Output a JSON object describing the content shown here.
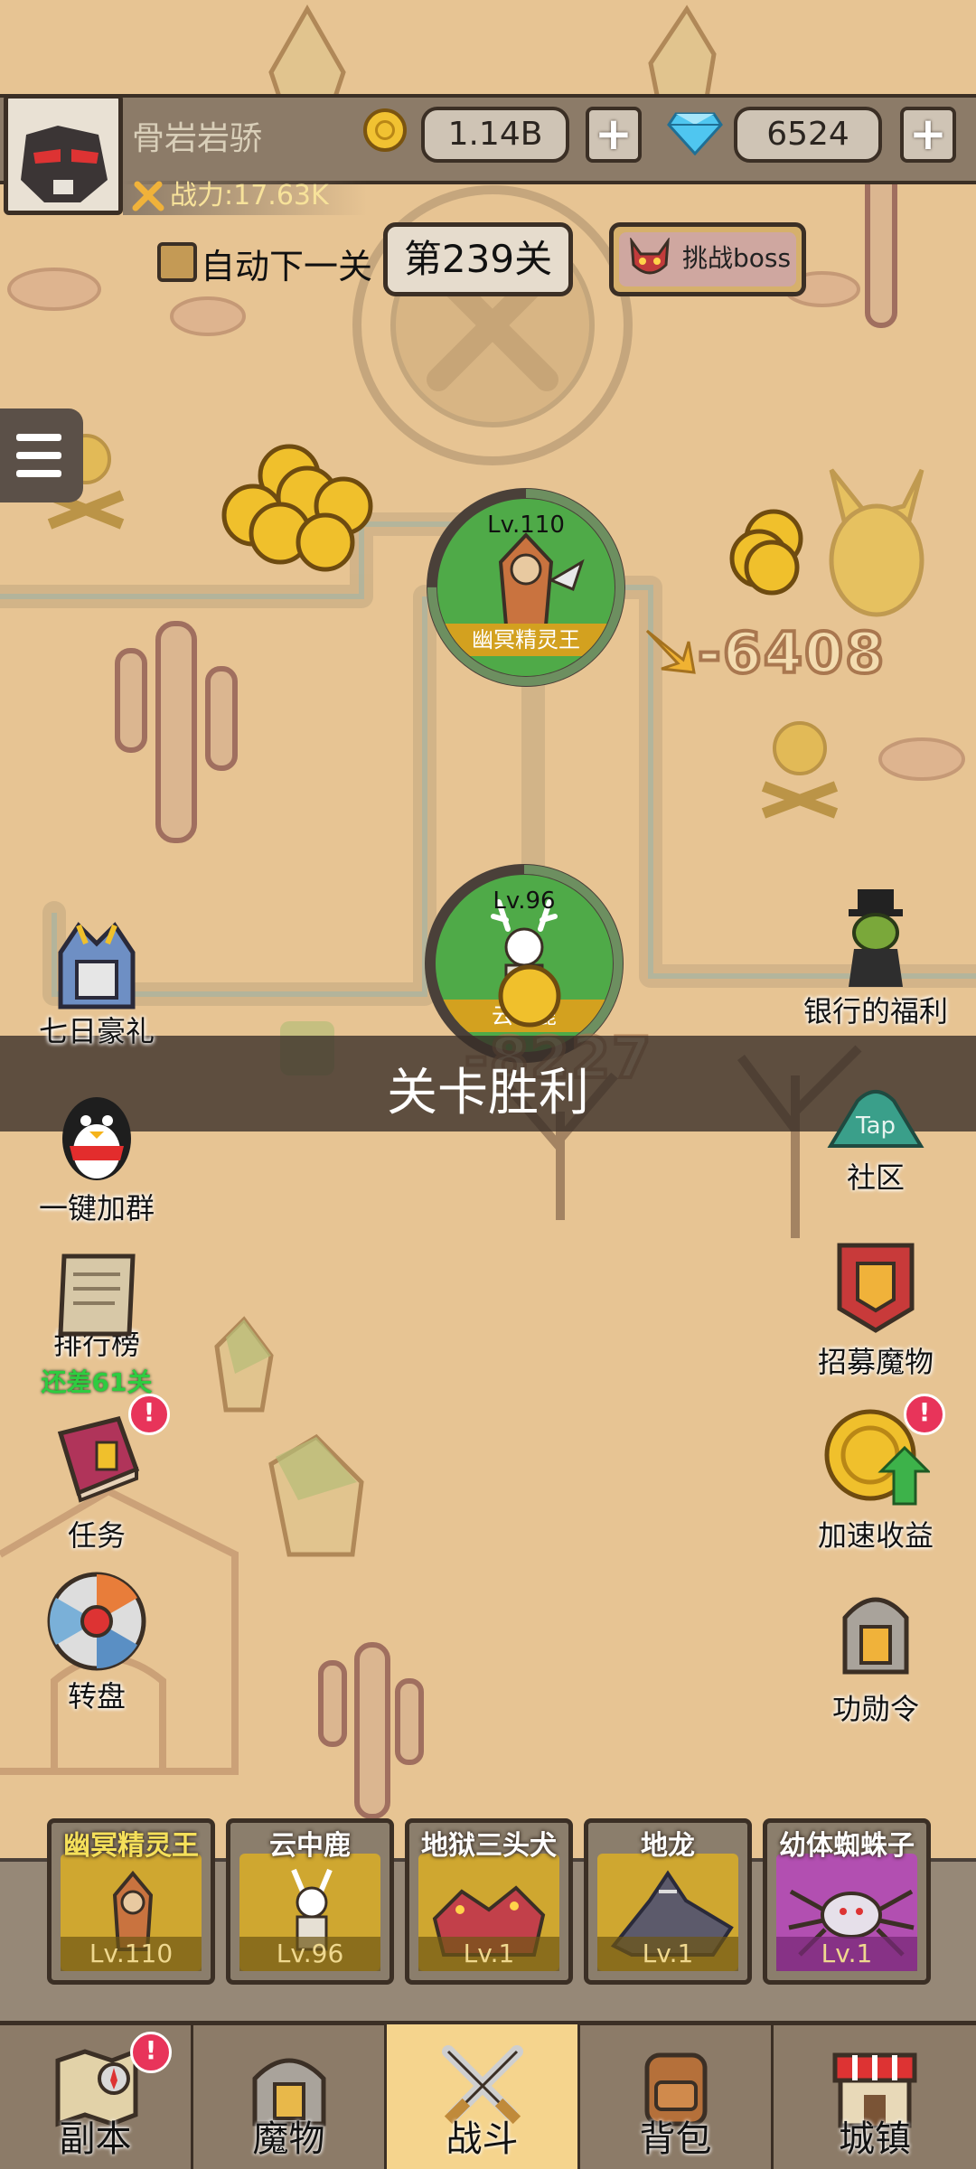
{
  "player": {
    "name": "骨岩岩骄",
    "power_label": "战力:17.63K",
    "gold": "1.14B",
    "gems": "6524",
    "plus": "+"
  },
  "stage_controls": {
    "auto_next_label": "自动下一关",
    "auto_next_checked": false,
    "level_label": "第239关",
    "boss_button_label": "挑战boss"
  },
  "battle": {
    "enemy_top": {
      "level": "Lv.110",
      "name": "幽冥精灵王",
      "damage": "-6408",
      "hp_fraction": 0.75
    },
    "enemy_bottom": {
      "level": "Lv.96",
      "name": "云中鹿",
      "damage": "-8227",
      "hp_fraction": 0.4
    },
    "victory_banner": "关卡胜利"
  },
  "left_menu": [
    {
      "label": "七日豪礼",
      "icon": "knight-helmet-icon"
    },
    {
      "label": "一键加群",
      "icon": "penguin-icon"
    },
    {
      "label": "排行榜",
      "sub": "还差61关",
      "icon": "scroll-icon"
    },
    {
      "label": "任务",
      "icon": "book-icon",
      "badge": "!"
    },
    {
      "label": "转盘",
      "icon": "wheel-icon"
    }
  ],
  "right_menu": [
    {
      "label": "银行的福利",
      "icon": "goblin-banker-icon"
    },
    {
      "label": "社区",
      "icon": "tap-community-icon",
      "icon_text": "Tap"
    },
    {
      "label": "招募魔物",
      "icon": "recruit-banner-icon"
    },
    {
      "label": "加速收益",
      "icon": "coin-boost-icon",
      "badge": "!"
    },
    {
      "label": "功勋令",
      "icon": "merit-helmet-icon"
    }
  ],
  "roster": [
    {
      "name": "幽冥精灵王",
      "level": "Lv.110",
      "color": "#cfa730",
      "name_color": "#f5e05a"
    },
    {
      "name": "云中鹿",
      "level": "Lv.96",
      "color": "#cfa730",
      "name_color": "#ffffff"
    },
    {
      "name": "地狱三头犬",
      "level": "Lv.1",
      "color": "#cfa730",
      "name_color": "#ffffff"
    },
    {
      "name": "地龙",
      "level": "Lv.1",
      "color": "#cfa730",
      "name_color": "#ffffff"
    },
    {
      "name": "幼体蜘蛛子",
      "level": "Lv.1",
      "color": "#b24fb1",
      "name_color": "#ffffff"
    }
  ],
  "bottom_nav": [
    {
      "label": "副本",
      "icon": "map-icon",
      "badge": "!"
    },
    {
      "label": "魔物",
      "icon": "monster-helmet-icon"
    },
    {
      "label": "战斗",
      "icon": "crossed-swords-icon",
      "active": true
    },
    {
      "label": "背包",
      "icon": "backpack-icon"
    },
    {
      "label": "城镇",
      "icon": "shop-icon"
    }
  ]
}
